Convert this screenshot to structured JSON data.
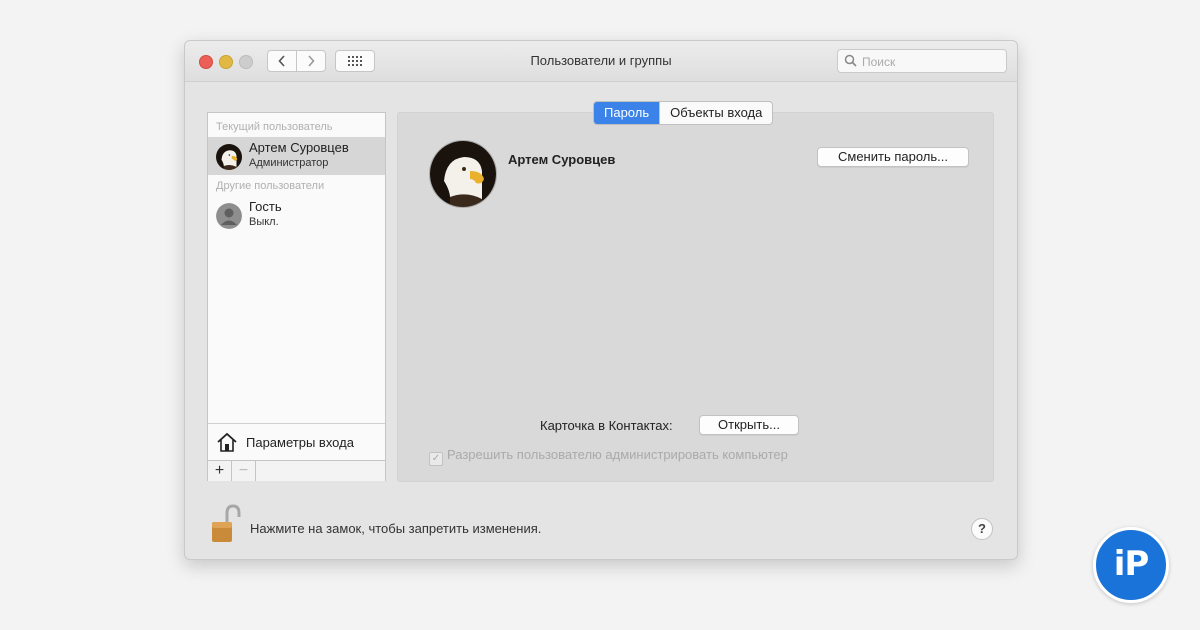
{
  "window": {
    "title": "Пользователи и группы",
    "search_placeholder": "Поиск"
  },
  "sidebar": {
    "current_header": "Текущий пользователь",
    "other_header": "Другие пользователи",
    "users": [
      {
        "name": "Артем Суровцев",
        "role": "Администратор"
      },
      {
        "name": "Гость",
        "role": "Выкл."
      }
    ],
    "login_options": "Параметры входа",
    "add": "+",
    "remove": "−"
  },
  "tabs": [
    {
      "label": "Пароль",
      "active": true
    },
    {
      "label": "Объекты входа",
      "active": false
    }
  ],
  "main": {
    "user_name": "Артем Суровцев",
    "change_password": "Сменить пароль...",
    "contacts_label": "Карточка в Контактах:",
    "open_button": "Открыть...",
    "allow_admin": "Разрешить пользователю администрировать компьютер"
  },
  "footer": {
    "lock_text": "Нажмите на замок, чтобы запретить изменения.",
    "help": "?"
  },
  "logo": {
    "text": "iP"
  },
  "colors": {
    "accent": "#3b83e8",
    "logo_blue": "#1a73d9"
  }
}
